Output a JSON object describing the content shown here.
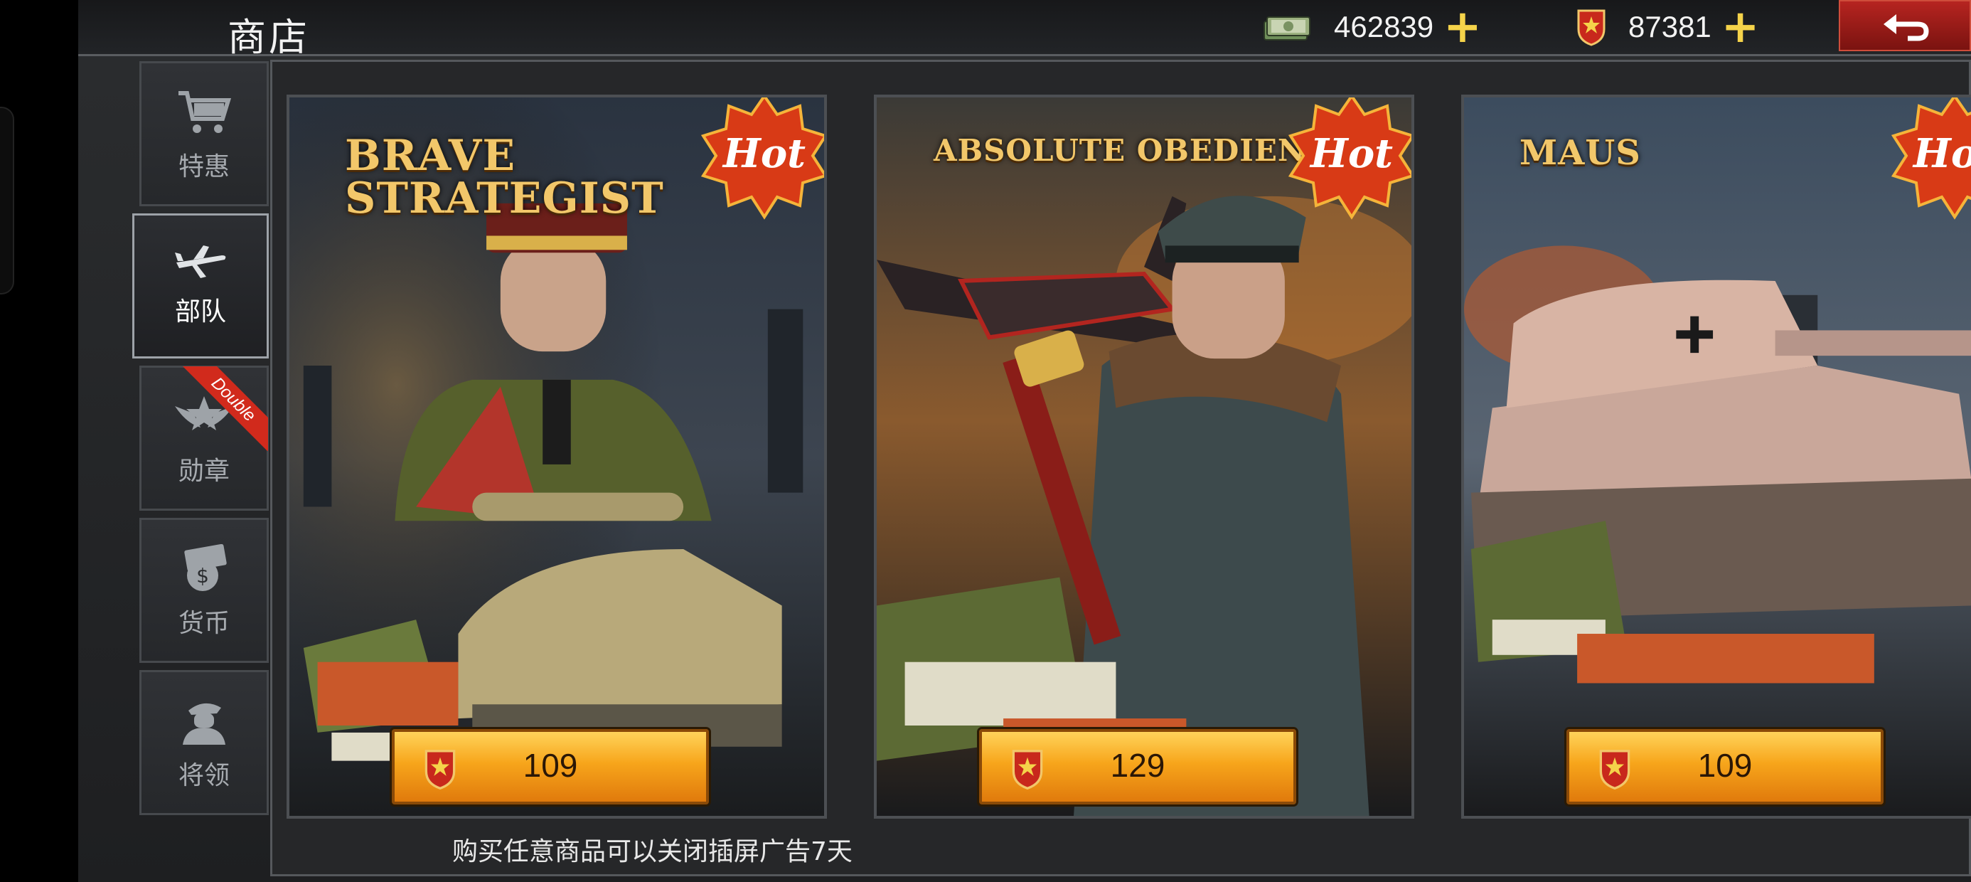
{
  "header": {
    "title": "商店",
    "cash_amount": "462839",
    "medal_amount": "87381",
    "cash_icon": "cash-stack-icon",
    "medal_icon": "medal-shield-icon",
    "back_icon": "return-arrow-icon"
  },
  "sidebar": {
    "items": [
      {
        "label": "特惠",
        "icon": "shopping-cart-icon"
      },
      {
        "label": "部队",
        "icon": "airplane-icon",
        "active": true
      },
      {
        "label": "勋章",
        "icon": "star-wings-icon",
        "badge": "Double"
      },
      {
        "label": "货币",
        "icon": "money-bag-icon"
      },
      {
        "label": "将领",
        "icon": "general-bust-icon"
      }
    ]
  },
  "cards": [
    {
      "title_line1": "BRAVE",
      "title_line2": "STRATEGIST",
      "badge": "Hot",
      "price": "109"
    },
    {
      "title_line1": "ABSOLUTE OBEDIENCE",
      "title_line2": "",
      "badge": "Hot",
      "price": "129"
    },
    {
      "title_line1": "MAUS",
      "title_line2": "",
      "badge": "Hot",
      "price": "109"
    }
  ],
  "footer_note": "购买任意商品可以关闭插屏广告7天",
  "colors": {
    "accent_gold": "#f2c76a",
    "button_orange": "#f7a51b",
    "back_red": "#b62420",
    "hot_red": "#d83a16"
  }
}
